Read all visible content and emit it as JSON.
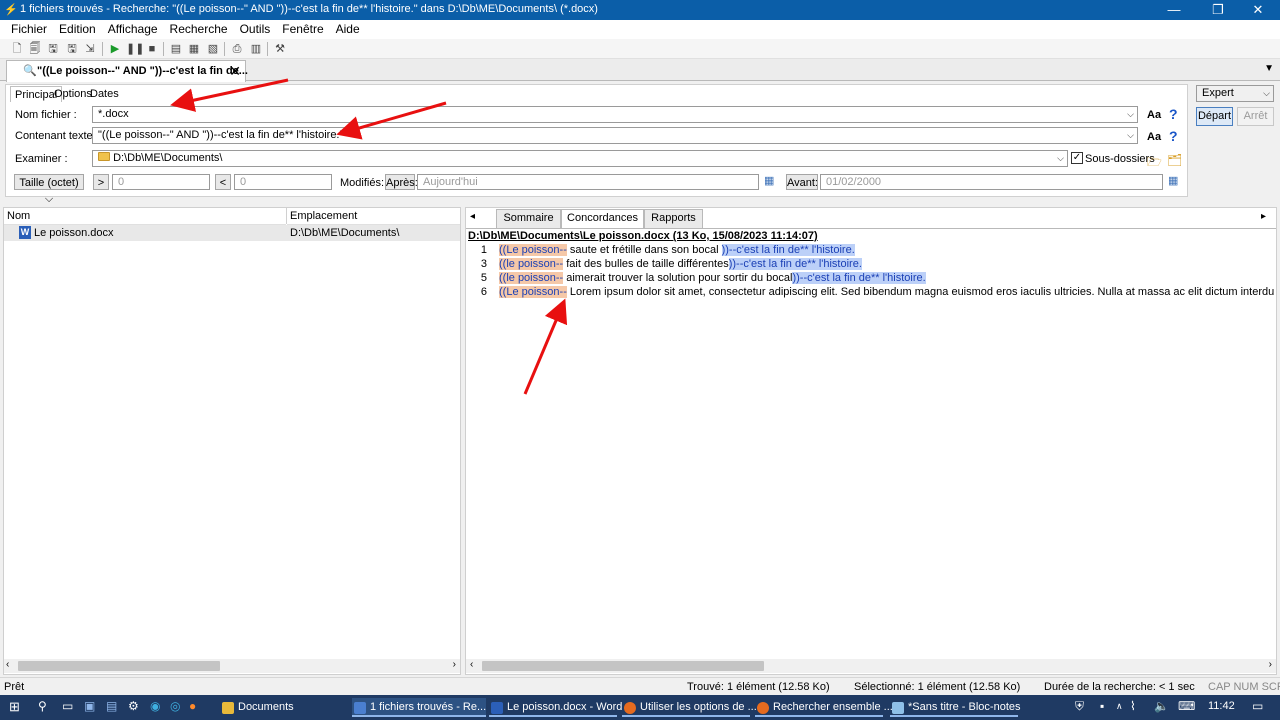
{
  "window": {
    "title": "1 fichiers trouvés - Recherche: \"((Le poisson--\" AND \"))--c'est la fin de** l'histoire.\" dans D:\\Db\\ME\\Documents\\ (*.docx)",
    "minimize": "—",
    "maximize": "❐",
    "close": "✕"
  },
  "menu": [
    "Fichier",
    "Edition",
    "Affichage",
    "Recherche",
    "Outils",
    "Fenêtre",
    "Aide"
  ],
  "toolbar_icons": [
    "new-icon",
    "open-icon",
    "save-icon",
    "save-as-icon",
    "play-icon",
    "pause-icon",
    "stop-icon",
    "layout1-icon",
    "layout2-icon",
    "export-icon",
    "print-icon",
    "preview-icon",
    "settings-icon"
  ],
  "doc_tab": {
    "label": "\"((Le poisson--\" AND \"))--c'est la fin de...",
    "close": "✕"
  },
  "search_tabs": [
    "Principal",
    "Options",
    "Dates"
  ],
  "search": {
    "file_name_label": "Nom fichier :",
    "file_name_value": "*.docx",
    "content_label": "Contenant texte :",
    "content_value": "\"((Le poisson--\" AND \"))--c'est la fin de** l'histoire.\"",
    "examine_label": "Examiner :",
    "examine_value": "D:\\Db\\ME\\Documents\\",
    "subfolders_label": "Sous-dossiers",
    "subfolders_checked": true,
    "size_label": "Taille (octet)",
    "gt": ">",
    "gt_value": "0",
    "lt": "<",
    "lt_value": "0",
    "modified_label": "Modifiés:",
    "after_label": "Après:",
    "after_value": "Aujourd'hui",
    "before_label": "Avant:",
    "before_value": "01/02/2000",
    "case_glyph": "Aa",
    "help_glyph": "?",
    "mode": "Expert",
    "start": "Départ",
    "stop": "Arrêt"
  },
  "results": {
    "col_name": "Nom",
    "col_location": "Emplacement",
    "rows": [
      {
        "name": "Le poisson.docx",
        "location": "D:\\Db\\ME\\Documents\\"
      }
    ]
  },
  "detail_tabs": [
    "Sommaire",
    "Concordances",
    "Rapports"
  ],
  "concordance": {
    "header": "D:\\Db\\ME\\Documents\\Le poisson.docx   (13 Ko,  15/08/2023 11:14:07)",
    "lines": [
      {
        "num": "1",
        "hit1": "((Le poisson--",
        "text": " saute et frétille dans son bocal ",
        "hit2": "))--c'est la fin de** l'histoire."
      },
      {
        "num": "3",
        "hit1": "((le poisson--",
        "text": " fait des bulles de taille différentes",
        "hit2": "))--c'est la fin de** l'histoire."
      },
      {
        "num": "5",
        "hit1": "((le poisson--",
        "text": " aimerait trouver la solution pour sortir du bocal",
        "hit2": "))--c'est la fin de** l'histoire."
      },
      {
        "num": "6",
        "hit1": "((Le poisson--",
        "text": " Lorem ipsum dolor sit amet, consectetur adipiscing elit. Sed bibendum magna euismod eros iaculis ultricies. Nulla at massa ac elit dictum interdum et et elit. Sed con",
        "hit2": ""
      }
    ]
  },
  "status": {
    "ready": "Prêt",
    "found": "Trouvé: 1 élément (12.58 Ko)",
    "selected": "Sélectionné: 1 élément (12.58 Ko)",
    "duration": "Durée de la recherche: < 1 sec",
    "caps": "CAP  NUM  SCRL"
  },
  "taskbar": {
    "items": [
      {
        "label": "Documents",
        "color": "#e8b93a"
      },
      {
        "label": "1 fichiers trouvés - Re...",
        "color": "#4a7fd0"
      },
      {
        "label": "Le poisson.docx - Word",
        "color": "#2b5fb8"
      },
      {
        "label": "Utiliser les options de ...",
        "color": "#e66b1f"
      },
      {
        "label": "Rechercher ensemble ...",
        "color": "#e66b1f"
      },
      {
        "label": "*Sans titre - Bloc-notes",
        "color": "#8fc0e8"
      }
    ],
    "time": "11:42"
  }
}
